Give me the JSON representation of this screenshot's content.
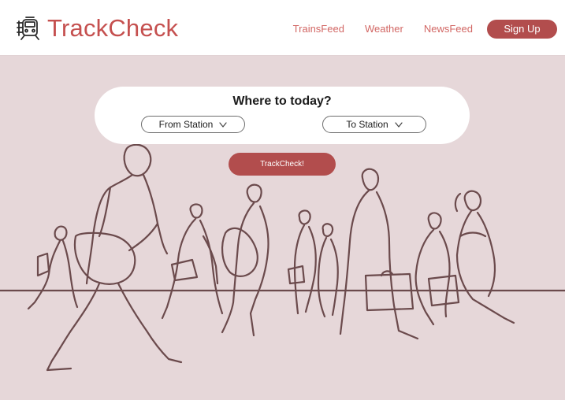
{
  "app": {
    "name": "TrackCheck",
    "logo_icon": "train-icon"
  },
  "nav": {
    "items": [
      {
        "label": "TrainsFeed"
      },
      {
        "label": "Weather"
      },
      {
        "label": "NewsFeed"
      }
    ],
    "signup_label": "Sign Up"
  },
  "search": {
    "title": "Where to today?",
    "from_label": "From Station",
    "to_label": "To Station",
    "submit_label": "TrackCheck!"
  },
  "hero": {
    "illustration": "people-walking-line-art"
  },
  "colors": {
    "brand": "#c5504f",
    "button": "#b24d4d",
    "background": "#e6d7d9",
    "line_art": "#6b4a4c"
  }
}
